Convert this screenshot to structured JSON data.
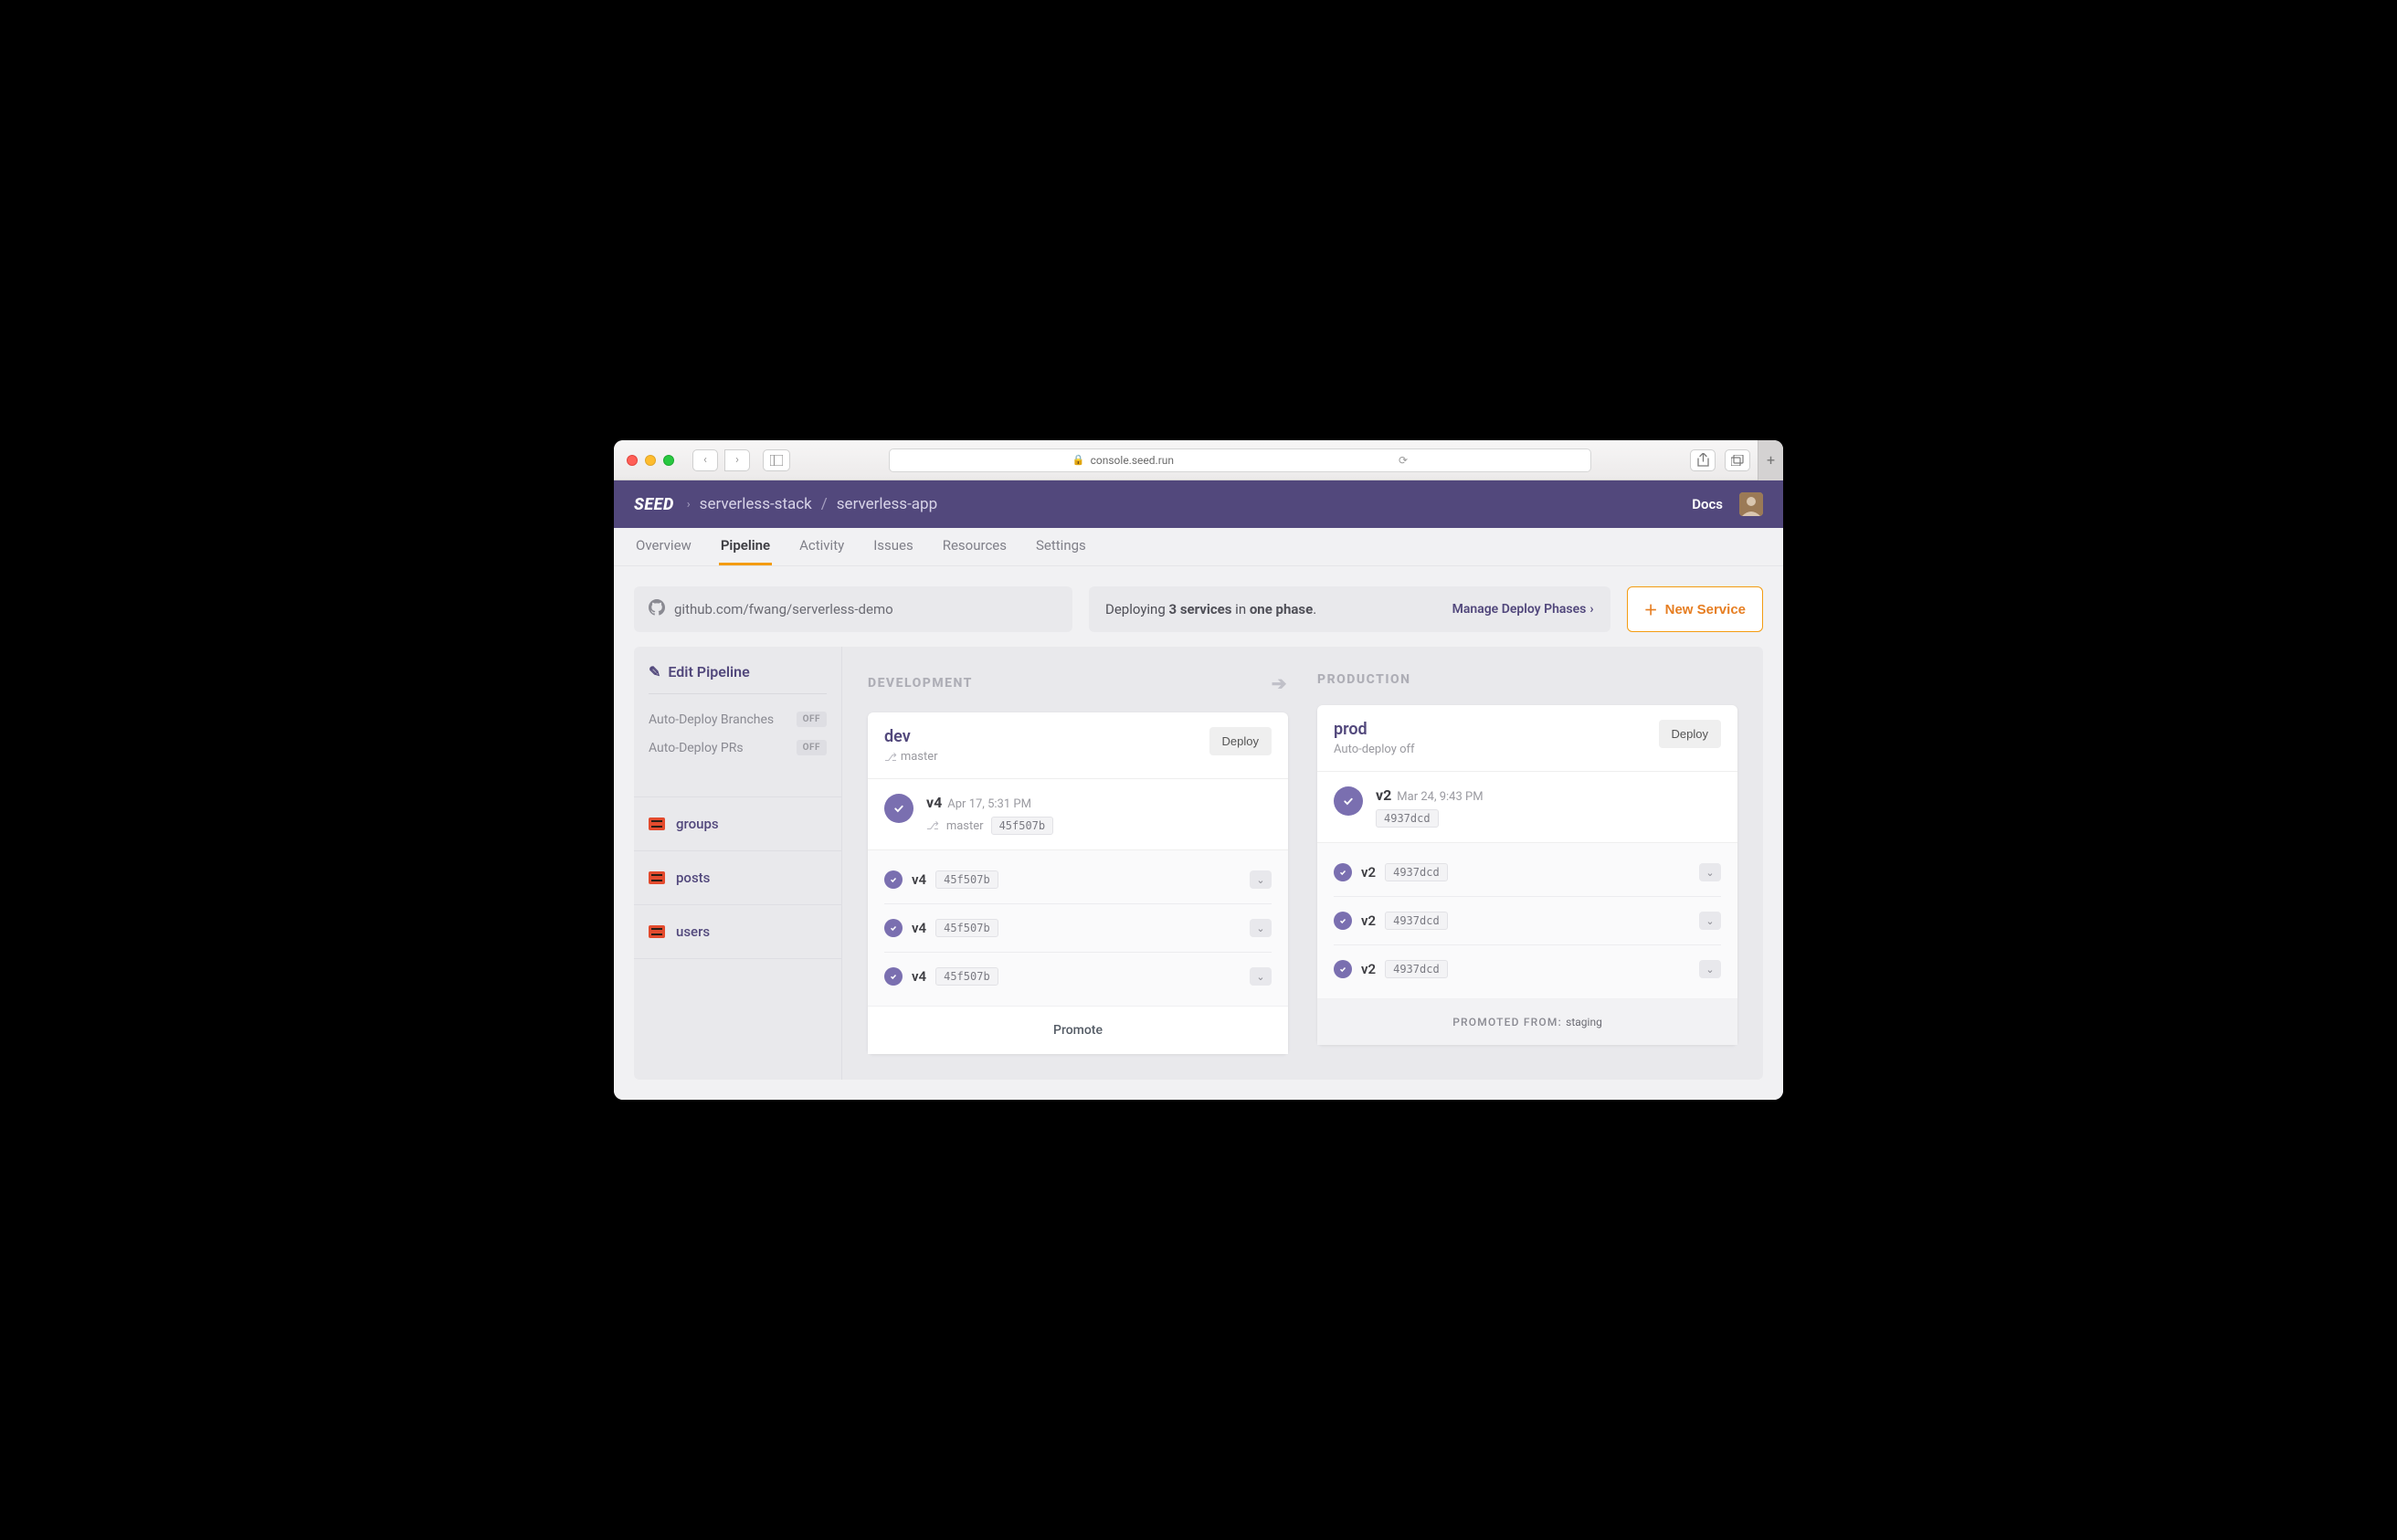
{
  "browser": {
    "url": "console.seed.run"
  },
  "header": {
    "logo": "SEED",
    "breadcrumb": {
      "org": "serverless-stack",
      "app": "serverless-app"
    },
    "docs": "Docs"
  },
  "subnav": {
    "items": [
      {
        "label": "Overview"
      },
      {
        "label": "Pipeline",
        "active": true
      },
      {
        "label": "Activity"
      },
      {
        "label": "Issues"
      },
      {
        "label": "Resources"
      },
      {
        "label": "Settings"
      }
    ]
  },
  "repo": {
    "url": "github.com/fwang/serverless-demo"
  },
  "deploy_info": {
    "prefix": "Deploying ",
    "services": "3 services",
    "mid": " in ",
    "phase": "one phase",
    "suffix": ".",
    "manage": "Manage Deploy Phases"
  },
  "new_service": "New Service",
  "sidebar": {
    "edit": "Edit Pipeline",
    "auto_branches": {
      "label": "Auto-Deploy Branches",
      "state": "OFF"
    },
    "auto_prs": {
      "label": "Auto-Deploy PRs",
      "state": "OFF"
    },
    "services": [
      {
        "name": "groups"
      },
      {
        "name": "posts"
      },
      {
        "name": "users"
      }
    ]
  },
  "stages": {
    "development": {
      "heading": "DEVELOPMENT",
      "name": "dev",
      "branch": "master",
      "deploy_btn": "Deploy",
      "current": {
        "version": "v4",
        "time": "Apr 17, 5:31 PM",
        "branch": "master",
        "commit": "45f507b"
      },
      "builds": [
        {
          "version": "v4",
          "commit": "45f507b"
        },
        {
          "version": "v4",
          "commit": "45f507b"
        },
        {
          "version": "v4",
          "commit": "45f507b"
        }
      ],
      "footer": "Promote"
    },
    "production": {
      "heading": "PRODUCTION",
      "name": "prod",
      "sub": "Auto-deploy off",
      "deploy_btn": "Deploy",
      "current": {
        "version": "v2",
        "time": "Mar 24, 9:43 PM",
        "commit": "4937dcd"
      },
      "builds": [
        {
          "version": "v2",
          "commit": "4937dcd"
        },
        {
          "version": "v2",
          "commit": "4937dcd"
        },
        {
          "version": "v2",
          "commit": "4937dcd"
        }
      ],
      "footer": {
        "label": "PROMOTED FROM:",
        "from": "staging"
      }
    }
  }
}
